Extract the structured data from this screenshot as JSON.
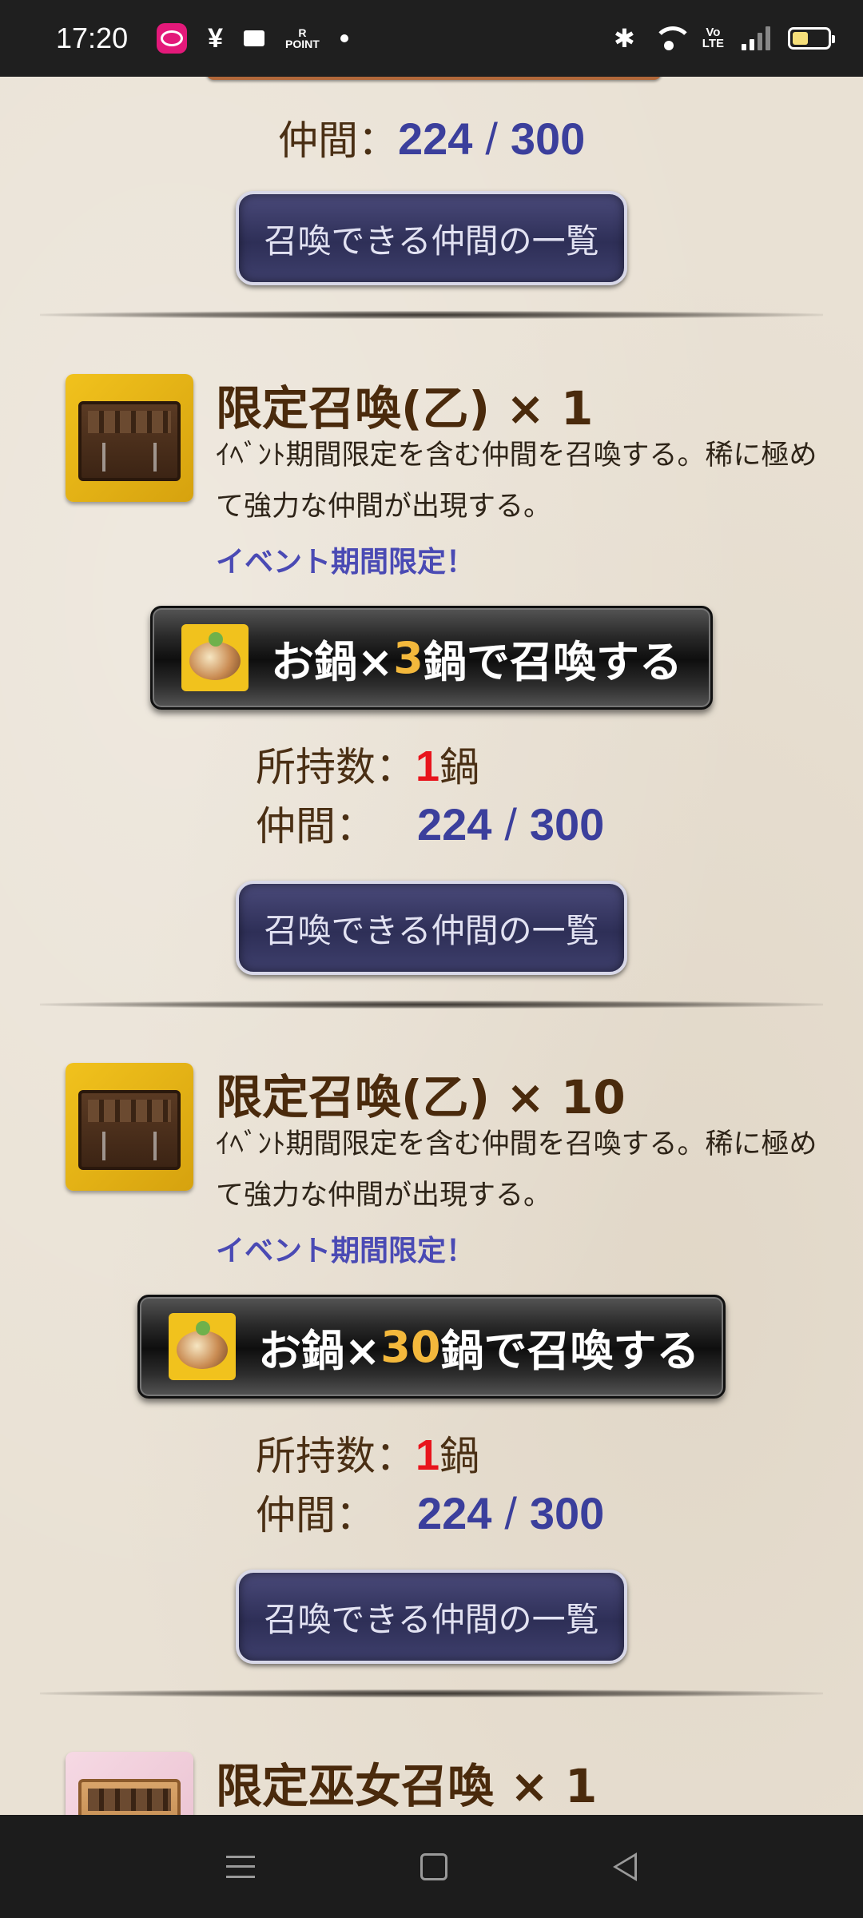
{
  "status_bar": {
    "time": "17:20",
    "icons": [
      "rakuten-link-icon",
      "yen-icon",
      "card-icon",
      "r-point-icon",
      "dot-icon",
      "bluetooth-icon",
      "wifi-icon",
      "volte-icon",
      "signal-icon",
      "battery-icon"
    ],
    "yen": "¥",
    "r_point": "R\nPOINT",
    "volte": "Vo\nLTE"
  },
  "top_section": {
    "companion_label": "仲間：",
    "companion_current": "224",
    "companion_sep": "/",
    "companion_max": "300",
    "list_button": "召喚できる仲間の一覧"
  },
  "items": [
    {
      "title": "限定召喚(乙) × 1",
      "description": "ｲﾍﾞﾝﾄ期間限定を含む仲間を召喚する。稀に極めて強力な仲間が出現する。",
      "limited": "イベント期間限定！",
      "summon": {
        "prefix": "お鍋×",
        "qty": "3",
        "suffix": "鍋で召喚する"
      },
      "owned_label": "所持数：",
      "owned_value": "1",
      "owned_unit": "鍋",
      "companion_label": "仲間：",
      "companion_current": "224",
      "companion_sep": "/",
      "companion_max": "300",
      "list_button": "召喚できる仲間の一覧"
    },
    {
      "title": "限定召喚(乙) × 10",
      "description": "ｲﾍﾞﾝﾄ期間限定を含む仲間を召喚する。稀に極めて強力な仲間が出現する。",
      "limited": "イベント期間限定！",
      "summon": {
        "prefix": "お鍋×",
        "qty": "30",
        "suffix": "鍋で召喚する"
      },
      "owned_label": "所持数：",
      "owned_value": "1",
      "owned_unit": "鍋",
      "companion_label": "仲間：",
      "companion_current": "224",
      "companion_sep": "/",
      "companion_max": "300",
      "list_button": "召喚できる仲間の一覧"
    },
    {
      "title": "限定巫女召喚 × 1"
    }
  ],
  "colors": {
    "accent_blue": "#3b3f9c",
    "owned_red": "#e8141c",
    "qty_yellow": "#f3b83c",
    "title_brown": "#4a2a0c"
  }
}
